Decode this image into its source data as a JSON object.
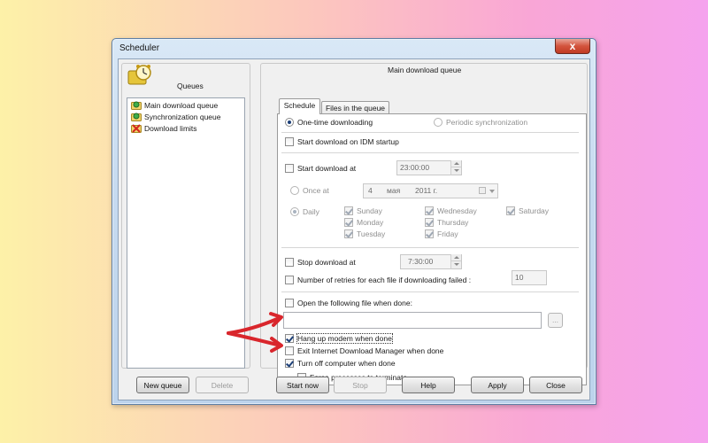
{
  "window": {
    "title": "Scheduler",
    "close_label": "x"
  },
  "left": {
    "queues_header": "Queues",
    "items": [
      {
        "label": "Main download queue",
        "icon": "queue-folder-green-icon"
      },
      {
        "label": "Synchronization queue",
        "icon": "queue-folder-green-icon"
      },
      {
        "label": "Download limits",
        "icon": "red-x-icon"
      }
    ],
    "new_queue_label": "New queue",
    "delete_label": "Delete"
  },
  "main": {
    "heading": "Main download queue",
    "tabs": [
      {
        "label": "Schedule"
      },
      {
        "label": "Files in the queue"
      }
    ],
    "one_time_label": "One-time downloading",
    "periodic_label": "Periodic synchronization",
    "start_on_startup_label": "Start download on IDM startup",
    "start_at_label": "Start download at",
    "start_time": "23:00:00",
    "once_at_label": "Once at",
    "date": {
      "day": "4",
      "month": "мая",
      "year": "2011 г."
    },
    "daily_label": "Daily",
    "days": {
      "sunday": "Sunday",
      "monday": "Monday",
      "tuesday": "Tuesday",
      "wednesday": "Wednesday",
      "thursday": "Thursday",
      "friday": "Friday",
      "saturday": "Saturday"
    },
    "stop_at_label": "Stop download at",
    "stop_time": "7:30:00",
    "retries_label": "Number of retries for each file if downloading failed :",
    "retries_value": "10",
    "open_file_label": "Open the following file when done:",
    "open_file_path": "",
    "browse_label": "...",
    "hang_up_label": "Hang up modem when done",
    "exit_idm_label": "Exit Internet Download Manager when done",
    "turn_off_label": "Turn off computer when done",
    "force_label": "Force processes to terminate"
  },
  "buttons": {
    "start_now": "Start now",
    "stop": "Stop",
    "help": "Help",
    "apply": "Apply",
    "close": "Close"
  },
  "annotation_color": "#d9262c"
}
